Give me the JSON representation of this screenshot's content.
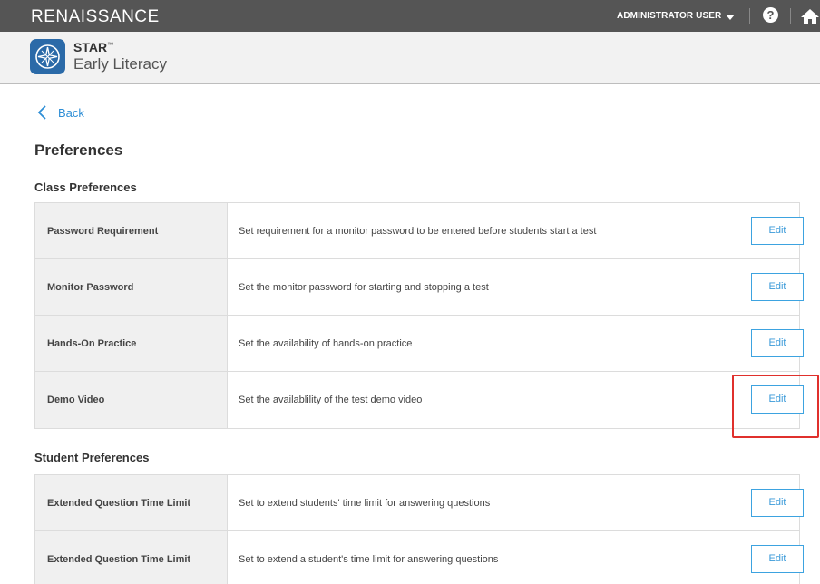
{
  "topbar": {
    "brand": "RENAISSANCE",
    "user_label": "ADMINISTRATOR USER",
    "help_glyph": "?",
    "icons": [
      "chevron-down-icon",
      "help-icon",
      "home-icon"
    ],
    "bg_color": "#555555"
  },
  "app": {
    "name": "STAR",
    "trademark": "™",
    "subtitle": "Early Literacy",
    "logo_icon": "compass-icon",
    "logo_color": "#2b6aa8"
  },
  "back": {
    "label": "Back"
  },
  "page_title": "Preferences",
  "class_preferences": {
    "heading": "Class Preferences",
    "rows": [
      {
        "name": "Password Requirement",
        "description": "Set requirement for a monitor password to be entered before students start a test",
        "action": "Edit"
      },
      {
        "name": "Monitor Password",
        "description": "Set the monitor password for starting and stopping a test",
        "action": "Edit"
      },
      {
        "name": "Hands-On Practice",
        "description": "Set the availability of hands-on practice",
        "action": "Edit"
      },
      {
        "name": "Demo Video",
        "description": "Set the availablility of the test demo video",
        "action": "Edit"
      }
    ]
  },
  "student_preferences": {
    "heading": "Student Preferences",
    "rows": [
      {
        "name": "Extended Question Time Limit",
        "description": "Set to extend students' time limit for answering questions",
        "action": "Edit"
      },
      {
        "name": "Extended Question Time Limit",
        "description": "Set to extend a student's time limit for answering questions",
        "action": "Edit"
      }
    ]
  },
  "colors": {
    "accent": "#3da3e0",
    "highlight": "#e0302c",
    "name_cell_bg": "#f0f0f0"
  }
}
